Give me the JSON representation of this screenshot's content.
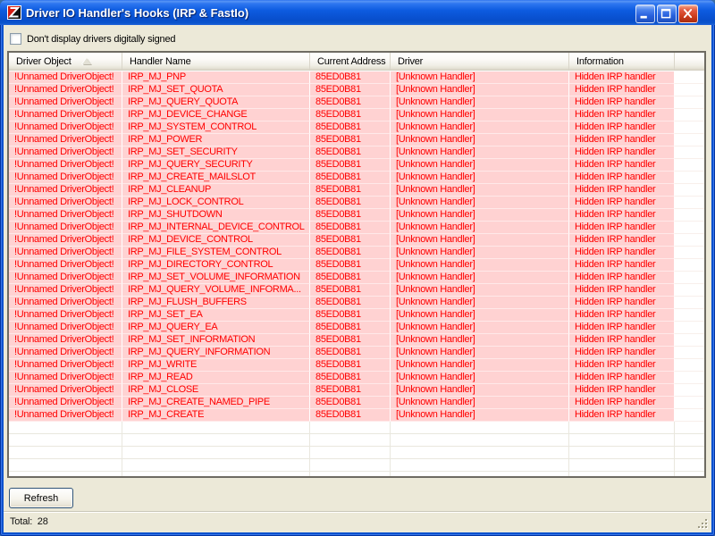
{
  "window": {
    "title": "Driver IO Handler's Hooks (IRP & FastIo)",
    "icon": "red-black-z-shield-icon",
    "controls": [
      "minimize",
      "maximize",
      "close"
    ]
  },
  "filter": {
    "checkbox_label": "Don't display drivers digitally signed",
    "checked": false
  },
  "table": {
    "columns": [
      {
        "key": "driver-object",
        "label": "Driver Object",
        "sort": "asc"
      },
      {
        "key": "handler-name",
        "label": "Handler Name"
      },
      {
        "key": "current-address",
        "label": "Current Address"
      },
      {
        "key": "driver",
        "label": "Driver"
      },
      {
        "key": "information",
        "label": "Information"
      }
    ],
    "rows": [
      [
        "!Unnamed DriverObject!",
        "IRP_MJ_PNP",
        "85ED0B81",
        "[Unknown Handler]",
        "Hidden IRP handler"
      ],
      [
        "!Unnamed DriverObject!",
        "IRP_MJ_SET_QUOTA",
        "85ED0B81",
        "[Unknown Handler]",
        "Hidden IRP handler"
      ],
      [
        "!Unnamed DriverObject!",
        "IRP_MJ_QUERY_QUOTA",
        "85ED0B81",
        "[Unknown Handler]",
        "Hidden IRP handler"
      ],
      [
        "!Unnamed DriverObject!",
        "IRP_MJ_DEVICE_CHANGE",
        "85ED0B81",
        "[Unknown Handler]",
        "Hidden IRP handler"
      ],
      [
        "!Unnamed DriverObject!",
        "IRP_MJ_SYSTEM_CONTROL",
        "85ED0B81",
        "[Unknown Handler]",
        "Hidden IRP handler"
      ],
      [
        "!Unnamed DriverObject!",
        "IRP_MJ_POWER",
        "85ED0B81",
        "[Unknown Handler]",
        "Hidden IRP handler"
      ],
      [
        "!Unnamed DriverObject!",
        "IRP_MJ_SET_SECURITY",
        "85ED0B81",
        "[Unknown Handler]",
        "Hidden IRP handler"
      ],
      [
        "!Unnamed DriverObject!",
        "IRP_MJ_QUERY_SECURITY",
        "85ED0B81",
        "[Unknown Handler]",
        "Hidden IRP handler"
      ],
      [
        "!Unnamed DriverObject!",
        "IRP_MJ_CREATE_MAILSLOT",
        "85ED0B81",
        "[Unknown Handler]",
        "Hidden IRP handler"
      ],
      [
        "!Unnamed DriverObject!",
        "IRP_MJ_CLEANUP",
        "85ED0B81",
        "[Unknown Handler]",
        "Hidden IRP handler"
      ],
      [
        "!Unnamed DriverObject!",
        "IRP_MJ_LOCK_CONTROL",
        "85ED0B81",
        "[Unknown Handler]",
        "Hidden IRP handler"
      ],
      [
        "!Unnamed DriverObject!",
        "IRP_MJ_SHUTDOWN",
        "85ED0B81",
        "[Unknown Handler]",
        "Hidden IRP handler"
      ],
      [
        "!Unnamed DriverObject!",
        "IRP_MJ_INTERNAL_DEVICE_CONTROL",
        "85ED0B81",
        "[Unknown Handler]",
        "Hidden IRP handler"
      ],
      [
        "!Unnamed DriverObject!",
        "IRP_MJ_DEVICE_CONTROL",
        "85ED0B81",
        "[Unknown Handler]",
        "Hidden IRP handler"
      ],
      [
        "!Unnamed DriverObject!",
        "IRP_MJ_FILE_SYSTEM_CONTROL",
        "85ED0B81",
        "[Unknown Handler]",
        "Hidden IRP handler"
      ],
      [
        "!Unnamed DriverObject!",
        "IRP_MJ_DIRECTORY_CONTROL",
        "85ED0B81",
        "[Unknown Handler]",
        "Hidden IRP handler"
      ],
      [
        "!Unnamed DriverObject!",
        "IRP_MJ_SET_VOLUME_INFORMATION",
        "85ED0B81",
        "[Unknown Handler]",
        "Hidden IRP handler"
      ],
      [
        "!Unnamed DriverObject!",
        "IRP_MJ_QUERY_VOLUME_INFORMA...",
        "85ED0B81",
        "[Unknown Handler]",
        "Hidden IRP handler"
      ],
      [
        "!Unnamed DriverObject!",
        "IRP_MJ_FLUSH_BUFFERS",
        "85ED0B81",
        "[Unknown Handler]",
        "Hidden IRP handler"
      ],
      [
        "!Unnamed DriverObject!",
        "IRP_MJ_SET_EA",
        "85ED0B81",
        "[Unknown Handler]",
        "Hidden IRP handler"
      ],
      [
        "!Unnamed DriverObject!",
        "IRP_MJ_QUERY_EA",
        "85ED0B81",
        "[Unknown Handler]",
        "Hidden IRP handler"
      ],
      [
        "!Unnamed DriverObject!",
        "IRP_MJ_SET_INFORMATION",
        "85ED0B81",
        "[Unknown Handler]",
        "Hidden IRP handler"
      ],
      [
        "!Unnamed DriverObject!",
        "IRP_MJ_QUERY_INFORMATION",
        "85ED0B81",
        "[Unknown Handler]",
        "Hidden IRP handler"
      ],
      [
        "!Unnamed DriverObject!",
        "IRP_MJ_WRITE",
        "85ED0B81",
        "[Unknown Handler]",
        "Hidden IRP handler"
      ],
      [
        "!Unnamed DriverObject!",
        "IRP_MJ_READ",
        "85ED0B81",
        "[Unknown Handler]",
        "Hidden IRP handler"
      ],
      [
        "!Unnamed DriverObject!",
        "IRP_MJ_CLOSE",
        "85ED0B81",
        "[Unknown Handler]",
        "Hidden IRP handler"
      ],
      [
        "!Unnamed DriverObject!",
        "IRP_MJ_CREATE_NAMED_PIPE",
        "85ED0B81",
        "[Unknown Handler]",
        "Hidden IRP handler"
      ],
      [
        "!Unnamed DriverObject!",
        "IRP_MJ_CREATE",
        "85ED0B81",
        "[Unknown Handler]",
        "Hidden IRP handler"
      ]
    ]
  },
  "toolbar": {
    "refresh_label": "Refresh"
  },
  "statusbar": {
    "total_text": "Total:  28"
  },
  "colors": {
    "row_highlight": "#FFD2D2",
    "row_text": "#FF0000",
    "titlebar_blue": "#0D5BE0",
    "window_border": "#0A52CE",
    "client_bg": "#ECE9D8"
  }
}
